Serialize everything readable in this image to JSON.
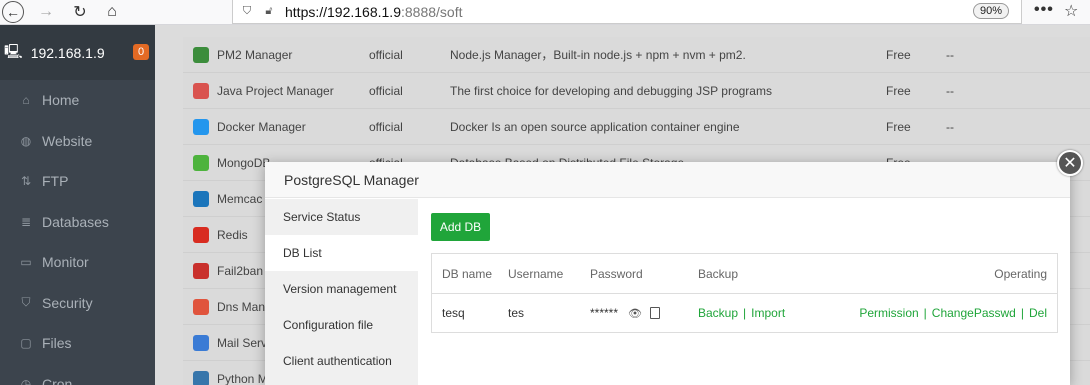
{
  "browser": {
    "url_main": "https://192.168.1.9",
    "url_port_path": ":8888/soft",
    "zoom": "90%",
    "menu_dots": "•••"
  },
  "sidebar": {
    "host": "192.168.1.9",
    "badge": "0",
    "items": [
      {
        "label": "Home",
        "icon": "home-icon"
      },
      {
        "label": "Website",
        "icon": "globe-icon"
      },
      {
        "label": "FTP",
        "icon": "ftp-icon"
      },
      {
        "label": "Databases",
        "icon": "database-icon"
      },
      {
        "label": "Monitor",
        "icon": "monitor-icon"
      },
      {
        "label": "Security",
        "icon": "shield-icon"
      },
      {
        "label": "Files",
        "icon": "folder-icon"
      },
      {
        "label": "Cron",
        "icon": "clock-icon"
      }
    ]
  },
  "software_list": [
    {
      "name": "PM2 Manager",
      "type": "official",
      "desc": "Node.js Manager，Built-in node.js + npm + nvm + pm2.",
      "price": "Free",
      "expire": "--",
      "icon_color": "#3c8d3c"
    },
    {
      "name": "Java Project Manager",
      "type": "official",
      "desc": "The first choice for developing and debugging JSP programs",
      "price": "Free",
      "expire": "--",
      "icon_color": "#d9534f"
    },
    {
      "name": "Docker Manager",
      "type": "official",
      "desc": "Docker Is an open source application container engine",
      "price": "Free",
      "expire": "--",
      "icon_color": "#2496ed"
    },
    {
      "name": "MongoDB",
      "type": "official",
      "desc": "Database Based on Distributed File Storage",
      "price": "Free",
      "expire": "",
      "icon_color": "#4db33d"
    },
    {
      "name": "Memcac",
      "type": "",
      "desc": "",
      "price": "",
      "expire": "",
      "icon_color": "#1b75bb"
    },
    {
      "name": "Redis",
      "type": "",
      "desc": "",
      "price": "",
      "expire": "",
      "icon_color": "#d82c20"
    },
    {
      "name": "Fail2ban",
      "type": "",
      "desc": "",
      "price": "",
      "expire": "",
      "icon_color": "#c9302c"
    },
    {
      "name": "Dns Man",
      "type": "",
      "desc": "",
      "price": "",
      "expire": "",
      "icon_color": "#e0543d"
    },
    {
      "name": "Mail Serv",
      "type": "",
      "desc": "",
      "price": "",
      "expire": "",
      "icon_color": "#3a7bd5"
    },
    {
      "name": "Python M",
      "type": "",
      "desc": "",
      "price": "",
      "expire": "",
      "icon_color": "#3776ab"
    }
  ],
  "modal": {
    "title": "PostgreSQL Manager",
    "tabs": [
      "Service Status",
      "DB List",
      "Version management",
      "Configuration file",
      "Client authentication"
    ],
    "active_tab": "DB List",
    "add_button": "Add DB",
    "table": {
      "headers": [
        "DB name",
        "Username",
        "Password",
        "Backup",
        "Operating"
      ],
      "rows": [
        {
          "db": "tesq",
          "user": "tes",
          "password": "******",
          "backup": "Backup",
          "import": "Import",
          "ops": [
            "Permission",
            "ChangePasswd",
            "Del"
          ]
        }
      ]
    },
    "accent": "#20a53a"
  }
}
